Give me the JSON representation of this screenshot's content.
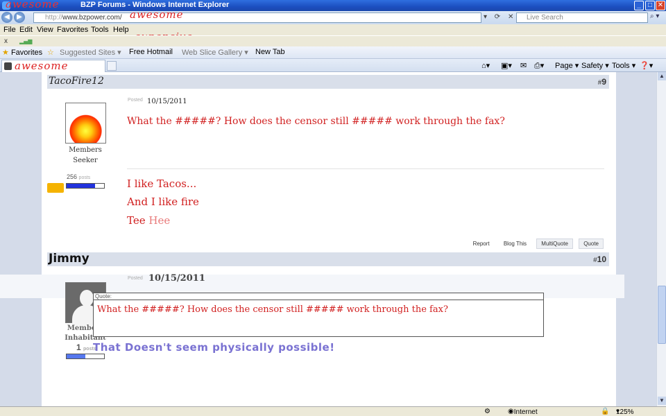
{
  "window": {
    "title": "BZP Forums - Windows Internet Explorer",
    "title_scribble": "awesome",
    "minimize": "_",
    "maximize": "□",
    "close": "✕"
  },
  "address_bar": {
    "scheme": "http://",
    "url": "www.bzpower.com/",
    "scribble": "awesome",
    "search_placeholder": "Live Search"
  },
  "menu": {
    "items": [
      "File",
      "Edit",
      "View",
      "Favorites",
      "Tools",
      "Help"
    ],
    "scribble": "expensive"
  },
  "links_row": {
    "close": "x"
  },
  "favorites_bar": {
    "favorites": "Favorites",
    "suggested": "Suggested Sites ▾",
    "hotmail": "Free Hotmail",
    "web_slice": "Web Slice Gallery ▾",
    "new_tab": "New Tab"
  },
  "tab": {
    "scribble": "awesome"
  },
  "command_bar": {
    "page": "Page ▾",
    "safety": "Safety ▾",
    "tools": "Tools ▾",
    "help": "❓▾"
  },
  "posts": [
    {
      "username": "TacoFire12",
      "post_number": "#",
      "post_number_value": "9",
      "posted_label": "Posted",
      "date": "10/15/2011",
      "rank_group": "Members",
      "rank_title": "Seeker",
      "post_count": "256",
      "post_count_label": "posts",
      "message": "What the #####? How does the censor still ##### work through the fax?",
      "signature_lines": [
        "I like Tacos...",
        "And I like fire"
      ],
      "signature_tee": "Tee",
      "signature_hee": "Hee",
      "post_bar_fill": 0.75,
      "actions": [
        "Report",
        "Blog This",
        "MultiQuote",
        "Quote"
      ]
    },
    {
      "username": "Jimmy",
      "post_number": "#",
      "post_number_value": "10",
      "posted_label": "Posted",
      "date": "10/15/2011",
      "rank_group": "Members",
      "rank_title": "Inhabitant",
      "post_count": "1",
      "post_count_label": "posts",
      "quote_label": "Quote:",
      "quote_text": "What the #####? How does the censor still ##### work through the fax?",
      "reply": "That Doesn't seem physically possible!",
      "post_bar_fill": 0.5
    }
  ],
  "status_bar": {
    "zone": "Internet",
    "zoom": "125%"
  },
  "colors": {
    "titlebar": "#1c4fc0",
    "scribble_red": "#dd2222",
    "post_text_red": "#d12020",
    "reply_purple": "#7a72d2",
    "header_bg": "#d9dfea"
  }
}
